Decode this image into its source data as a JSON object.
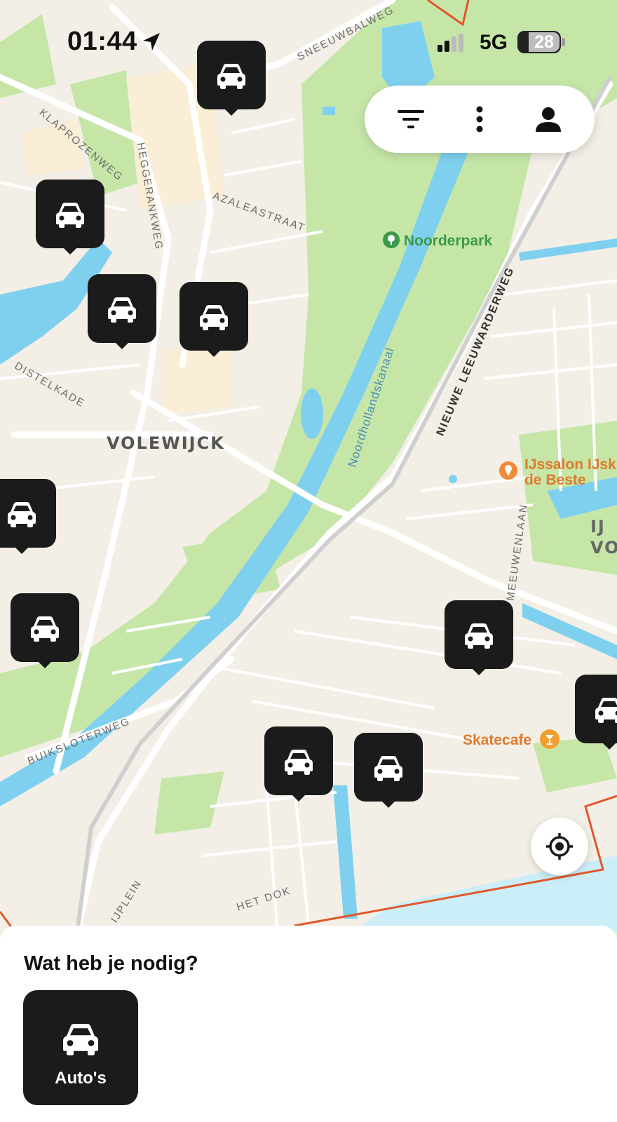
{
  "status_bar": {
    "time": "01:44",
    "network": "5G",
    "battery": "28"
  },
  "map": {
    "street_labels": [
      "SNEEUWBALWEG",
      "KLAPROZENWEG",
      "HEGGERANKWEG",
      "AZALEASTRAAT",
      "DISTELKADE",
      "NIEUWE LEEUWARDERWEG",
      "Noordhollandskanaal",
      "MEEUWENLAAN",
      "BUIKSLOTERWEG",
      "HET DOK",
      "IJPLEIN"
    ],
    "district": "VOLEWIJCK",
    "district_partial": "IJ\nVOG",
    "pois": {
      "park": "Noorderpark",
      "icecream_line1": "IJssalon IJsk",
      "icecream_line2": "de Beste",
      "skatecafe": "Skatecafe"
    },
    "car_pin_count": 11,
    "colors": {
      "park": "#c6e6a8",
      "water": "#7fd0ef",
      "pin": "#1b1b1b",
      "boundary": "#e2572a",
      "poi_orange": "#e07a2a",
      "poi_green": "#3a9a4a"
    }
  },
  "toolbar": {
    "filter_icon": "filter-icon",
    "more_icon": "more-vertical-icon",
    "profile_icon": "profile-icon"
  },
  "bottom_sheet": {
    "title": "Wat heb je nodig?",
    "categories": [
      {
        "label": "Auto's",
        "icon": "car-icon"
      }
    ]
  }
}
